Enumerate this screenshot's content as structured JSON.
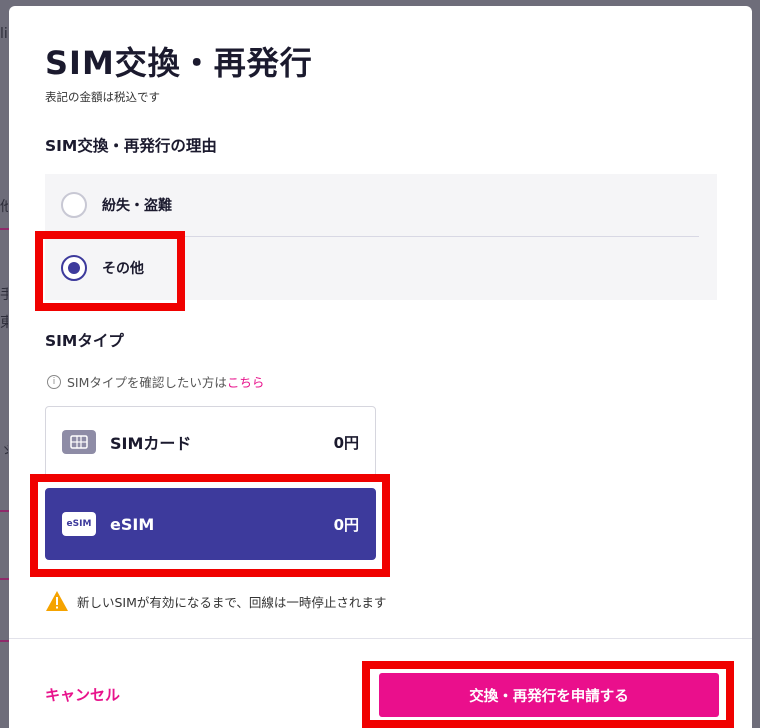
{
  "modal": {
    "title": "SIM交換・再発行",
    "tax_note": "表記の金額は税込です"
  },
  "reason_section": {
    "heading": "SIM交換・再発行の理由",
    "options": [
      {
        "label": "紛失・盗難",
        "selected": false
      },
      {
        "label": "その他",
        "selected": true
      }
    ]
  },
  "sim_type_section": {
    "heading": "SIMタイプ",
    "info_text": "SIMタイプを確認したい方は",
    "info_link": "こちら",
    "options": [
      {
        "name": "SIMカード",
        "price": "0円",
        "selected": false,
        "icon": "sim-card-icon"
      },
      {
        "name": "eSIM",
        "price": "0円",
        "selected": true,
        "icon": "esim-icon",
        "icon_text": "eSIM"
      }
    ]
  },
  "warning": {
    "text": "新しいSIMが有効になるまで、回線は一時停止されます"
  },
  "footer": {
    "cancel_label": "キャンセル",
    "apply_label": "交換・再発行を申請する"
  },
  "colors": {
    "accent": "#3d3a9c",
    "brand_pink": "#ea0f8c",
    "highlight_red": "#f00100",
    "warning_yellow": "#f5a300"
  }
}
